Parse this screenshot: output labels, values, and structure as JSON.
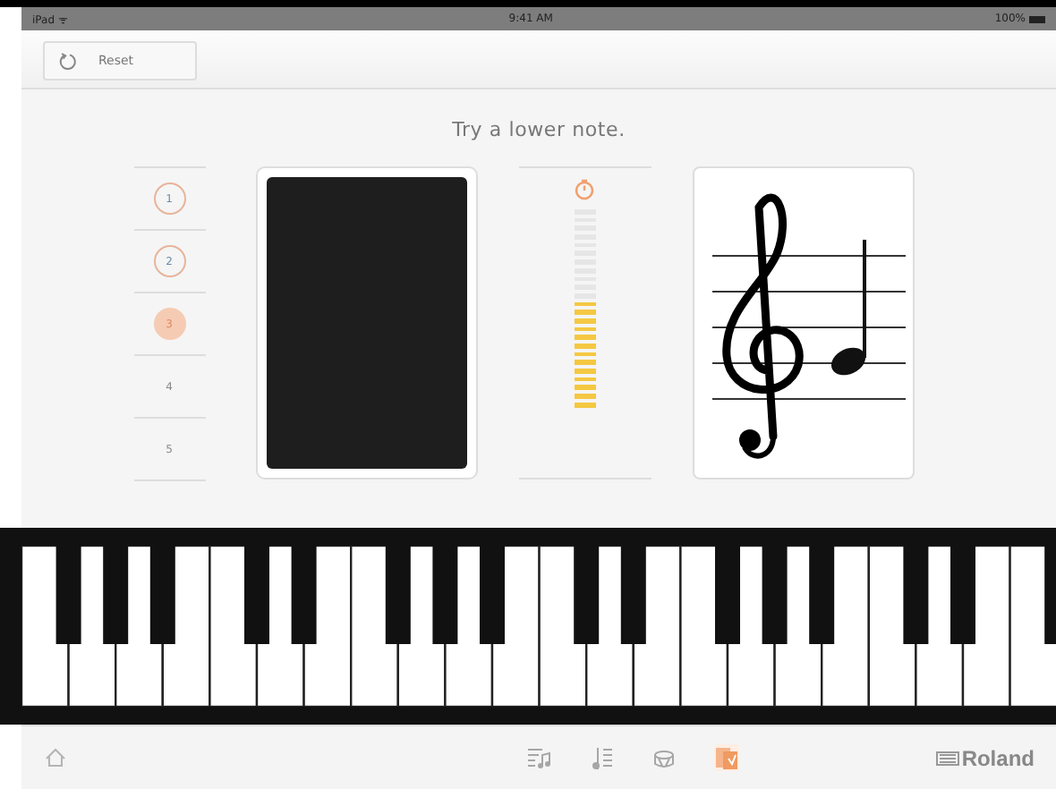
{
  "status_bar": {
    "carrier": "iPad ᯤ",
    "time": "9:41 AM",
    "battery": "100%"
  },
  "toolbar": {
    "reset_label": "Reset"
  },
  "prompt": "Try a lower note.",
  "attempts": [
    {
      "label": "1",
      "kind": "tried"
    },
    {
      "label": "2",
      "kind": "tried"
    },
    {
      "label": "3",
      "kind": "current"
    },
    {
      "label": "4",
      "kind": "pending"
    },
    {
      "label": "5",
      "kind": "pending"
    }
  ],
  "meter": {
    "level": 0.55
  },
  "nav": [
    {
      "kind": "home",
      "selected": false
    },
    {
      "kind": "songs",
      "selected": false
    },
    {
      "kind": "score",
      "selected": false
    },
    {
      "kind": "drum",
      "selected": false
    },
    {
      "kind": "flashcard",
      "selected": true
    }
  ],
  "brand": "Roland"
}
